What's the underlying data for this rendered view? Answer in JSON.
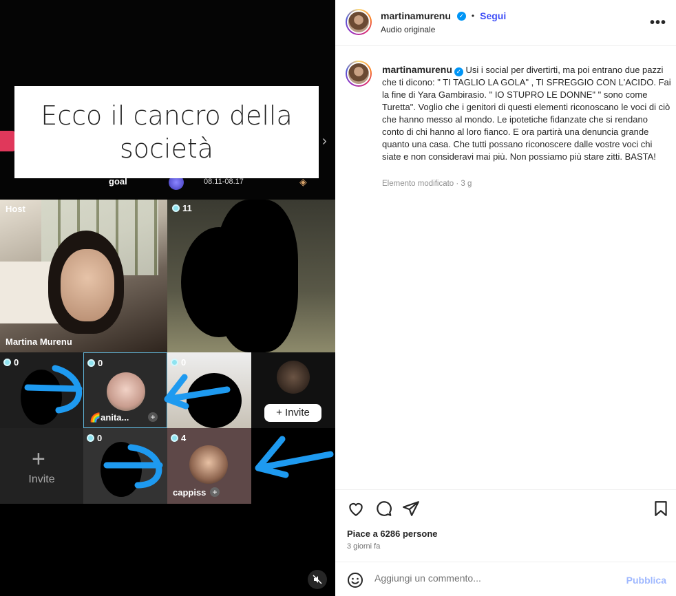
{
  "post": {
    "username": "martinamurenu",
    "follow_label": "Segui",
    "audio": "Audio originale",
    "caption_text": "Usi i social per divertirti, ma poi entrano due pazzi che ti dicono: \" TI TAGLIO LA GOLA\" , TI SFREGGIO CON L'ACIDO. Fai la fine di Yara Gambirasio. \" IO STUPRO LE DONNE\" \" sono come Turetta\". Voglio che i genitori di questi elementi riconoscano le voci di ciò che hanno messo al mondo. Le ipotetiche fidanzate che si rendano conto di chi hanno al loro fianco. E ora partirà una denuncia grande quanto una casa. Che tutti possano riconoscere dalle vostre voci chi siate e non consideravi mai più. Non possiamo più stare zitti. BASTA!",
    "edited": "Elemento modificato · 3 g",
    "likes": "Piace a 6286 persone",
    "date": "3 giorni fa",
    "comment_placeholder": "Aggiungi un commento...",
    "publish_label": "Pubblica"
  },
  "media": {
    "overlay_text": "Ecco il cancro della società",
    "goal_label": "goal",
    "date_range": "08.11-08.17",
    "host_label": "Host",
    "host_name": "Martina Murenu",
    "counts": [
      "11",
      "0",
      "0",
      "0",
      "0",
      "4"
    ],
    "user_anita": "🌈anita...",
    "user_cappiss": "cappiss",
    "invite_button": "+ Invite",
    "invite_label": "Invite"
  },
  "icons": [
    "heart-icon",
    "comment-icon",
    "share-icon",
    "bookmark-icon",
    "emoji-icon",
    "more-icon",
    "mute-icon",
    "verified-icon"
  ],
  "colors": {
    "follow": "#4150f7",
    "verified": "#0095f6",
    "publish": "#9fb8ff",
    "arrow": "#1e9af0"
  }
}
